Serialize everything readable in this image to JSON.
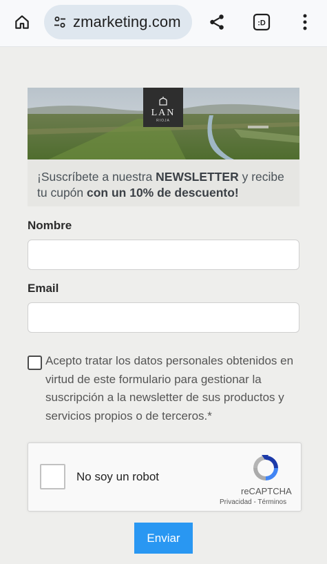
{
  "browser": {
    "url": "zmarketing.com",
    "tab_count": ":D"
  },
  "banner": {
    "logo_text": "LAN",
    "logo_subtext": "RIOJA"
  },
  "newsletter": {
    "part1": "¡Suscríbete a nuestra ",
    "part2": "NEWSLETTER",
    "part3": " y recibe tu cupón ",
    "part4": "con un 10% de descuento!"
  },
  "form": {
    "name_label": "Nombre",
    "name_value": "",
    "email_label": "Email",
    "email_value": "",
    "consent_text": "Acepto tratar los datos personales obtenidos en virtud de este formulario para gestionar la suscripción a la newsletter de sus productos y servicios propios o de terceros.*",
    "submit_label": "Enviar"
  },
  "recaptcha": {
    "label": "No soy un robot",
    "brand": "reCAPTCHA",
    "privacy": "Privacidad",
    "separator": " - ",
    "terms": "Términos"
  },
  "colors": {
    "submit": "#2997f2",
    "page_bg": "#eeeeec"
  }
}
